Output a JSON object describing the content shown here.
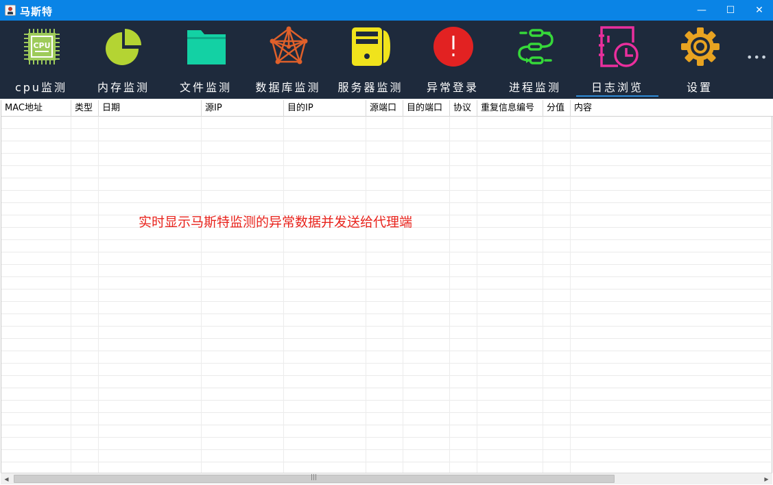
{
  "window": {
    "title": "马斯特",
    "minimize_glyph": "—",
    "maximize_glyph": "☐",
    "close_glyph": "✕"
  },
  "toolbar": {
    "items": [
      {
        "label": "cpu监测",
        "icon": "cpu-chip-icon",
        "color": "#9ecb5a"
      },
      {
        "label": "内存监测",
        "icon": "pie-chart-icon",
        "color": "#b4d433"
      },
      {
        "label": "文件监测",
        "icon": "folder-icon",
        "color": "#13d1a4"
      },
      {
        "label": "数据库监测",
        "icon": "network-graph-icon",
        "color": "#e0602a"
      },
      {
        "label": "服务器监测",
        "icon": "server-icon",
        "color": "#f0e31c"
      },
      {
        "label": "异常登录",
        "icon": "alert-icon",
        "color": "#e22222"
      },
      {
        "label": "进程监测",
        "icon": "process-flow-icon",
        "color": "#36d83a"
      },
      {
        "label": "日志浏览",
        "icon": "log-clock-icon",
        "color": "#ea2f9d",
        "active": true
      },
      {
        "label": "设置",
        "icon": "gear-icon",
        "color": "#e8a321"
      }
    ],
    "more_label": "•••",
    "cpu_chip_text": "CPU"
  },
  "table": {
    "columns": [
      "MAC地址",
      "类型",
      "日期",
      "源IP",
      "目的IP",
      "源端口",
      "目的端口",
      "协议",
      "重复信息编号",
      "分值",
      "内容"
    ],
    "overlay_message": "实时显示马斯特监测的异常数据并发送给代理端"
  },
  "scrollbar": {
    "left_arrow": "◀",
    "right_arrow": "▶",
    "grip": "|||"
  }
}
